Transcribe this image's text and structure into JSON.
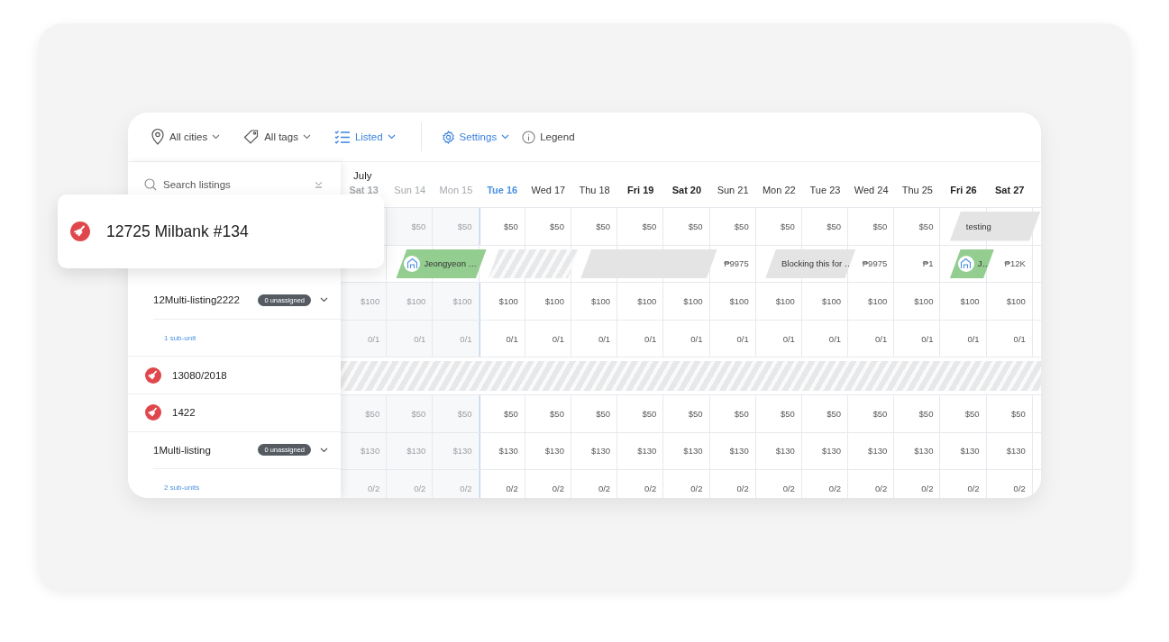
{
  "toolbar": {
    "filters": [
      {
        "label": "All cities",
        "active": false,
        "dropdown": true
      },
      {
        "label": "All tags",
        "active": false,
        "dropdown": true
      },
      {
        "label": "Listed",
        "active": true,
        "dropdown": true
      }
    ],
    "actions": [
      {
        "label": "Settings",
        "active": true,
        "dropdown": true
      },
      {
        "label": "Legend",
        "active": false,
        "dropdown": false
      }
    ]
  },
  "search": {
    "placeholder": "Search listings"
  },
  "highlighted_listing": {
    "name": "12725 Milbank #134"
  },
  "calendar": {
    "month": "July",
    "days": [
      {
        "label": "Sat 13",
        "bold": true,
        "past": true,
        "today": false
      },
      {
        "label": "Sun 14",
        "bold": false,
        "past": true,
        "today": false
      },
      {
        "label": "Mon 15",
        "bold": false,
        "past": true,
        "today": false
      },
      {
        "label": "Tue 16",
        "bold": true,
        "past": false,
        "today": true
      },
      {
        "label": "Wed 17",
        "bold": false,
        "past": false,
        "today": false
      },
      {
        "label": "Thu 18",
        "bold": false,
        "past": false,
        "today": false
      },
      {
        "label": "Fri 19",
        "bold": true,
        "past": false,
        "today": false
      },
      {
        "label": "Sat 20",
        "bold": true,
        "past": false,
        "today": false
      },
      {
        "label": "Sun 21",
        "bold": false,
        "past": false,
        "today": false
      },
      {
        "label": "Mon 22",
        "bold": false,
        "past": false,
        "today": false
      },
      {
        "label": "Tue 23",
        "bold": false,
        "past": false,
        "today": false
      },
      {
        "label": "Wed 24",
        "bold": false,
        "past": false,
        "today": false
      },
      {
        "label": "Thu 25",
        "bold": false,
        "past": false,
        "today": false
      },
      {
        "label": "Fri 26",
        "bold": true,
        "past": false,
        "today": false
      },
      {
        "label": "Sat 27",
        "bold": true,
        "past": false,
        "today": false
      }
    ],
    "rows": [
      {
        "blocked": false,
        "cells": [
          {},
          {
            "text": "$50"
          },
          {
            "text": "$50"
          },
          {
            "text": "$50"
          },
          {
            "text": "$50"
          },
          {
            "text": "$50"
          },
          {
            "text": "$50"
          },
          {
            "text": "$50"
          },
          {
            "text": "$50"
          },
          {
            "text": "$50"
          },
          {
            "text": "$50"
          },
          {
            "text": "$50"
          },
          {
            "text": "$50"
          },
          {
            "event": {
              "kind": "block",
              "label": "testing"
            }
          },
          {
            "continued": true
          }
        ]
      },
      {
        "blocked": false,
        "cells": [
          {},
          {
            "event": {
              "kind": "booking",
              "label": "Jeongyeon …"
            }
          },
          {
            "continued": true
          },
          {
            "event": {
              "kind": "unavailable"
            }
          },
          {
            "continued": true
          },
          {
            "event": {
              "kind": "block"
            }
          },
          {
            "continued": true
          },
          {
            "continued": true
          },
          {
            "text": "₱9975"
          },
          {
            "event": {
              "kind": "block",
              "label": "Blocking this for …"
            }
          },
          {
            "continued": true
          },
          {
            "text": "₱9975"
          },
          {
            "text": "₱1"
          },
          {
            "event": {
              "kind": "booking",
              "label": "J…"
            }
          },
          {
            "text": "₱12K"
          }
        ]
      },
      {
        "sidebar": {
          "kind": "multi",
          "name": "12Multi-listing2222",
          "badge": "0 unassigned",
          "expanded": false
        },
        "blocked": false,
        "cells": [
          {
            "text": "$100"
          },
          {
            "text": "$100"
          },
          {
            "text": "$100"
          },
          {
            "text": "$100"
          },
          {
            "text": "$100"
          },
          {
            "text": "$100"
          },
          {
            "text": "$100"
          },
          {
            "text": "$100"
          },
          {
            "text": "$100"
          },
          {
            "text": "$100"
          },
          {
            "text": "$100"
          },
          {
            "text": "$100"
          },
          {
            "text": "$100"
          },
          {
            "text": "$100"
          },
          {
            "text": "$100"
          }
        ]
      },
      {
        "sidebar": {
          "kind": "subunits",
          "link": "1 sub-unit"
        },
        "blocked": false,
        "cells": [
          {
            "text": "0/1"
          },
          {
            "text": "0/1"
          },
          {
            "text": "0/1"
          },
          {
            "text": "0/1"
          },
          {
            "text": "0/1"
          },
          {
            "text": "0/1"
          },
          {
            "text": "0/1"
          },
          {
            "text": "0/1"
          },
          {
            "text": "0/1"
          },
          {
            "text": "0/1"
          },
          {
            "text": "0/1"
          },
          {
            "text": "0/1"
          },
          {
            "text": "0/1"
          },
          {
            "text": "0/1"
          },
          {
            "text": "0/1"
          }
        ]
      },
      {
        "sidebar": {
          "kind": "listing",
          "name": "13080/2018"
        },
        "blocked": true
      },
      {
        "sidebar": {
          "kind": "listing",
          "name": "1422"
        },
        "blocked": false,
        "cells": [
          {
            "text": "$50"
          },
          {
            "text": "$50"
          },
          {
            "text": "$50"
          },
          {
            "text": "$50"
          },
          {
            "text": "$50"
          },
          {
            "text": "$50"
          },
          {
            "text": "$50"
          },
          {
            "text": "$50"
          },
          {
            "text": "$50"
          },
          {
            "text": "$50"
          },
          {
            "text": "$50"
          },
          {
            "text": "$50"
          },
          {
            "text": "$50"
          },
          {
            "text": "$50"
          },
          {
            "text": "$50"
          }
        ]
      },
      {
        "sidebar": {
          "kind": "multi",
          "name": "1Multi-listing",
          "badge": "0 unassigned",
          "expanded": false
        },
        "blocked": false,
        "cells": [
          {
            "text": "$130"
          },
          {
            "text": "$130"
          },
          {
            "text": "$130"
          },
          {
            "text": "$130"
          },
          {
            "text": "$130"
          },
          {
            "text": "$130"
          },
          {
            "text": "$130"
          },
          {
            "text": "$130"
          },
          {
            "text": "$130"
          },
          {
            "text": "$130"
          },
          {
            "text": "$130"
          },
          {
            "text": "$130"
          },
          {
            "text": "$130"
          },
          {
            "text": "$130"
          },
          {
            "text": "$130"
          }
        ]
      },
      {
        "sidebar": {
          "kind": "subunits",
          "link": "2 sub-units"
        },
        "blocked": false,
        "cells": [
          {
            "text": "0/2"
          },
          {
            "text": "0/2"
          },
          {
            "text": "0/2"
          },
          {
            "text": "0/2"
          },
          {
            "text": "0/2"
          },
          {
            "text": "0/2"
          },
          {
            "text": "0/2"
          },
          {
            "text": "0/2"
          },
          {
            "text": "0/2"
          },
          {
            "text": "0/2"
          },
          {
            "text": "0/2"
          },
          {
            "text": "0/2"
          },
          {
            "text": "0/2"
          },
          {
            "text": "0/2"
          },
          {
            "text": "0/2"
          }
        ]
      }
    ]
  }
}
